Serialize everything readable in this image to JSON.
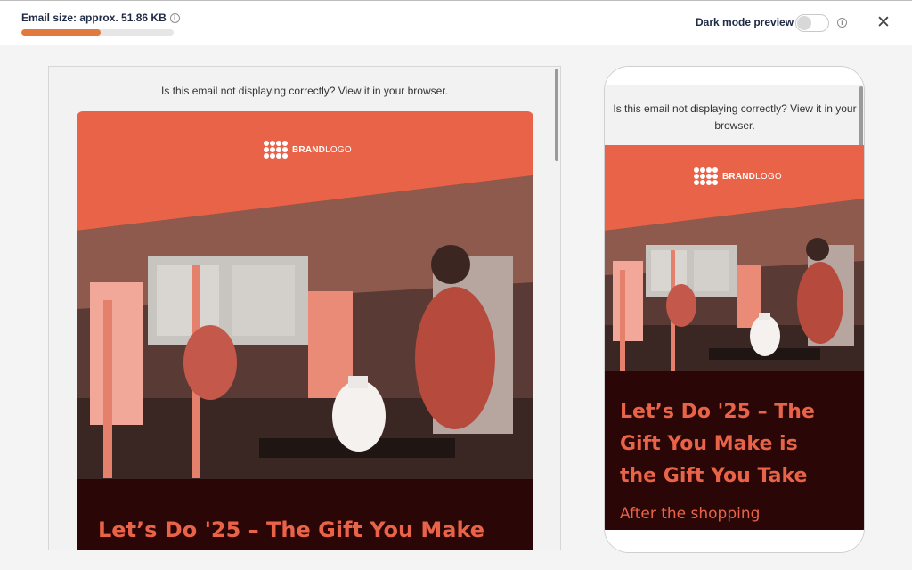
{
  "toolbar": {
    "email_size_label": "Email size: approx. 51.86 KB",
    "email_size_fraction": 0.52,
    "dark_mode_label": "Dark mode preview",
    "dark_mode_enabled": false,
    "info_icon": "info-icon",
    "close_icon": "close-icon",
    "info_glyph": "i",
    "close_glyph": "✕"
  },
  "email": {
    "preheader": "Is this email not displaying correctly? View it in your browser.",
    "logo_text_bold": "BRAND",
    "logo_text_regular": "LOGO",
    "headline": "Let’s Do '25 – The Gift You Make is the Gift You Take",
    "desktop_headline": "Let’s Do '25 – The Gift You Make",
    "mobile_headline_line1": "Let’s Do '25 – The",
    "mobile_headline_line2": "Gift You Make is",
    "mobile_headline_line3": "the Gift You Take",
    "subheadline": "After the shopping",
    "hero_image": "art-class-photo",
    "accent_color": "#e86347",
    "dark_bg_color": "#2a0606"
  }
}
